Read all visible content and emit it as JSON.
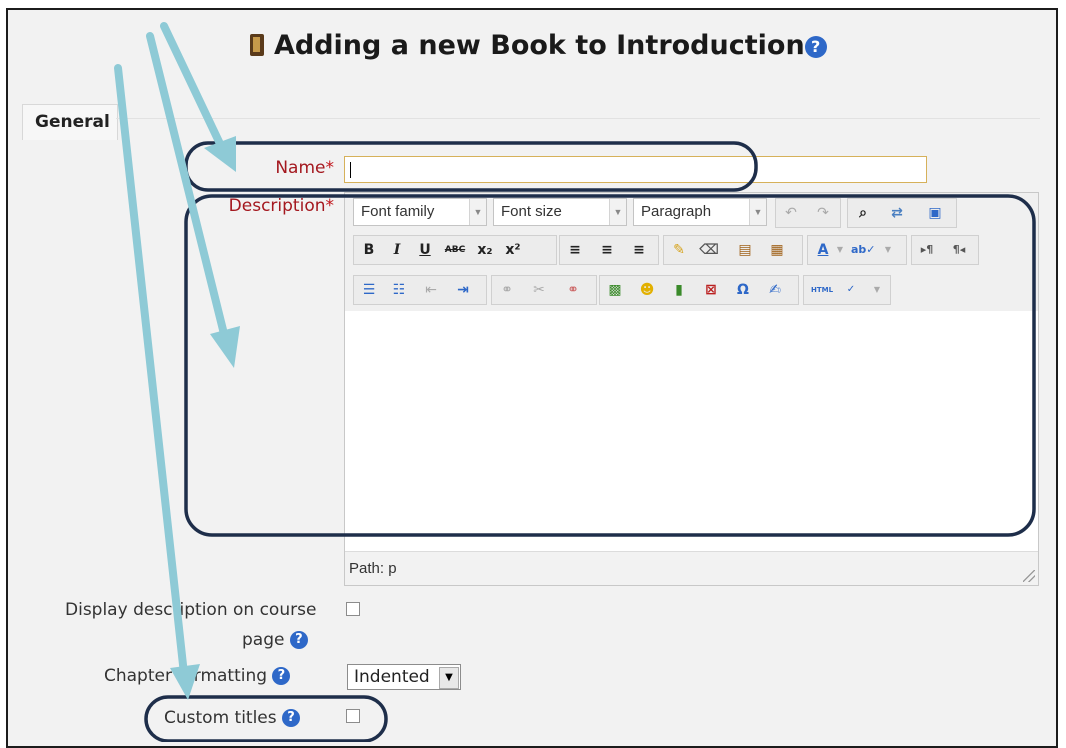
{
  "page": {
    "title": "Adding a new Book to Introduction",
    "icons": {
      "book": "book-icon",
      "help": "help-icon"
    }
  },
  "form": {
    "fieldset_legend": "General",
    "name": {
      "label": "Name",
      "required_mark": "*",
      "value": ""
    },
    "description": {
      "label": "Description",
      "required_mark": "*",
      "font_family": "Font family",
      "font_size": "Font size",
      "format": "Paragraph",
      "path_text": "Path: p"
    },
    "display_description": {
      "label_line1": "Display description on course",
      "label_line2": "page",
      "checked": false
    },
    "chapter_formatting": {
      "label": "Chapter formatting",
      "selected": "Indented"
    },
    "custom_titles": {
      "label": "Custom titles",
      "checked": false
    }
  },
  "toolbar": {
    "bold": "B",
    "italic": "I",
    "underline": "U",
    "strikethrough": "ABC",
    "subscript": "x₂",
    "superscript": "x²",
    "text_color": "A",
    "spellcheck": "ab✓",
    "ltr": "▸¶",
    "rtl": "¶◂",
    "omega": "Ω",
    "html": "HTML"
  },
  "colors": {
    "accent_arrow": "#8ecad6",
    "highlight_ring": "#1e2e4a",
    "required_label": "#a4181f",
    "help_icon": "#2e68c8"
  }
}
